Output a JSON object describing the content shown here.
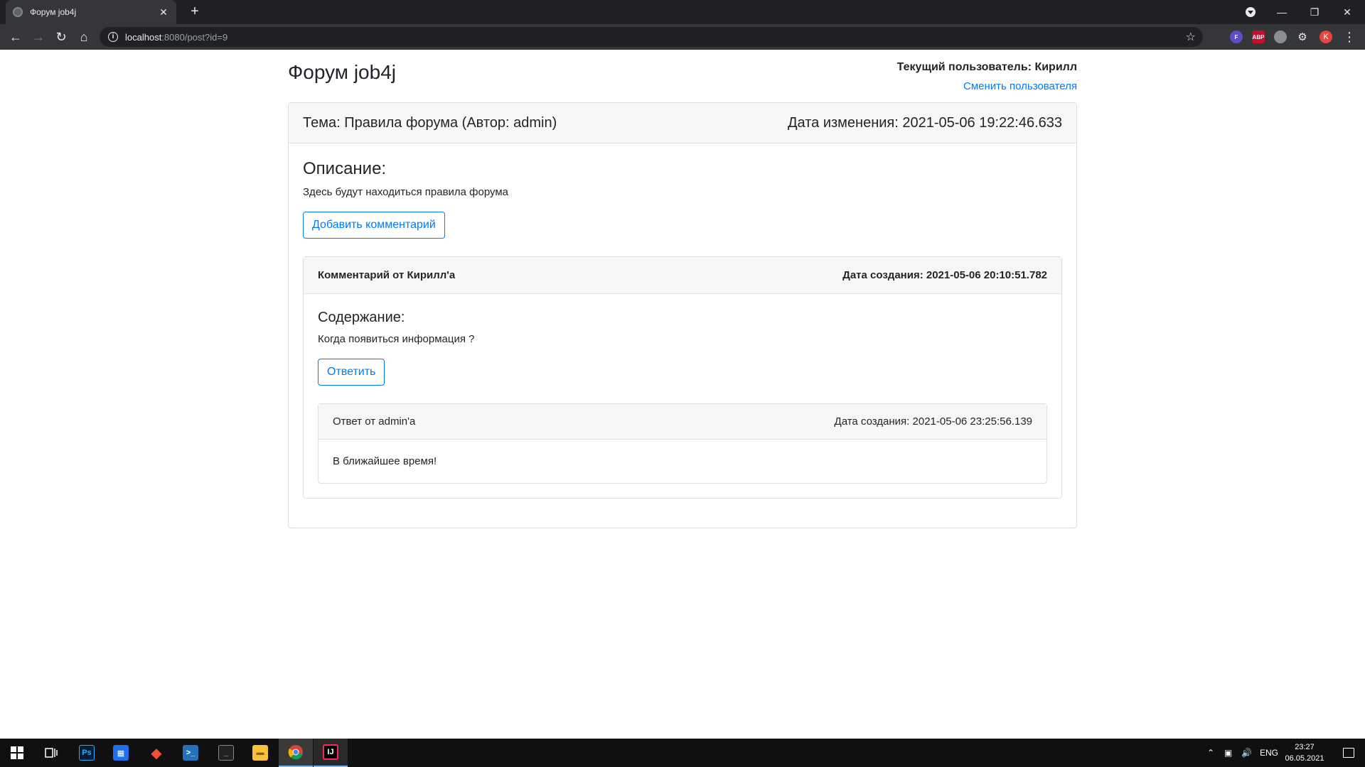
{
  "browser": {
    "tab_title": "Форум job4j",
    "tab_close": "✕",
    "new_tab": "+",
    "url_host": "localhost",
    "url_rest": ":8080/post?id=9",
    "avatar_letter": "K",
    "ext_abp": "ABP",
    "ext_f": "F",
    "avatar_color": "#e8453c"
  },
  "header": {
    "site_title": "Форум job4j",
    "current_user": "Текущий пользователь: Кирилл",
    "switch_user": "Сменить пользователя"
  },
  "post": {
    "topic": "Тема: Правила форума (Автор: admin)",
    "modified": "Дата изменения: 2021-05-06 19:22:46.633",
    "description_title": "Описание:",
    "description": "Здесь будут находиться правила форума",
    "add_comment_label": "Добавить комментарий"
  },
  "comment": {
    "author": "Комментарий от Кирилл'а",
    "created": "Дата создания: 2021-05-06 20:10:51.782",
    "content_title": "Содержание:",
    "content": "Когда появиться информация ?",
    "reply_label": "Ответить"
  },
  "reply": {
    "author": "Ответ от admin'a",
    "created": "Дата создания: 2021-05-06 23:25:56.139",
    "content": "В ближайшее время!"
  },
  "taskbar": {
    "language": "ENG",
    "time": "23:27",
    "date": "06.05.2021",
    "apps": [
      "start-icon",
      "task-view-icon",
      "photoshop-icon",
      "ide-icon",
      "git-icon",
      "powershell-icon",
      "terminal-icon",
      "file-explorer-icon",
      "chrome-icon",
      "intellij-icon"
    ]
  },
  "colors": {
    "link": "#007bff",
    "card_header_bg": "#f7f7f7",
    "card_border": "#dfdfdf"
  }
}
